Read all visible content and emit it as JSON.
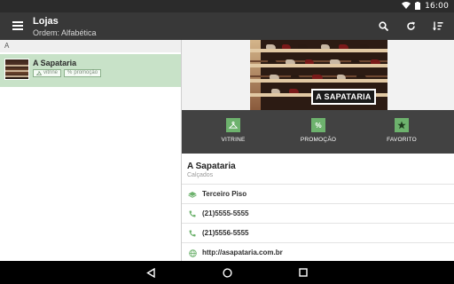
{
  "status_bar": {
    "time": "16:00",
    "icons": [
      "wifi-icon",
      "battery-icon"
    ]
  },
  "toolbar": {
    "title": "Lojas",
    "subtitle": "Ordem: Alfabética",
    "icons": [
      "menu-icon",
      "search-icon",
      "refresh-icon",
      "sort-icon"
    ]
  },
  "store_list": {
    "section_letter": "A",
    "items": [
      {
        "name": "A Sapataria",
        "badges": [
          "vitrine",
          "promoção"
        ]
      }
    ]
  },
  "store_detail": {
    "logo_text": "A SAPATARIA",
    "actions": [
      {
        "label": "VITRINE",
        "icon": "hanger-icon"
      },
      {
        "label": "PROMOÇÃO",
        "icon": "percent-icon"
      },
      {
        "label": "FAVORITO",
        "icon": "star-icon"
      }
    ],
    "name": "A Sapataria",
    "category": "Calçados",
    "info_rows": [
      {
        "icon": "floor-icon",
        "text": "Terceiro Piso"
      },
      {
        "icon": "phone-icon",
        "text": "(21)5555-5555"
      },
      {
        "icon": "phone-icon",
        "text": "(21)5556-5555"
      },
      {
        "icon": "web-icon",
        "text": "http://asapataria.com.br"
      }
    ]
  },
  "colors": {
    "accent_green": "#6db26d",
    "selected_row": "#c8e2c8",
    "toolbar": "#383838",
    "action_bar": "#424242"
  },
  "nav_bar": {
    "icons": [
      "back-icon",
      "home-icon",
      "recents-icon"
    ]
  }
}
